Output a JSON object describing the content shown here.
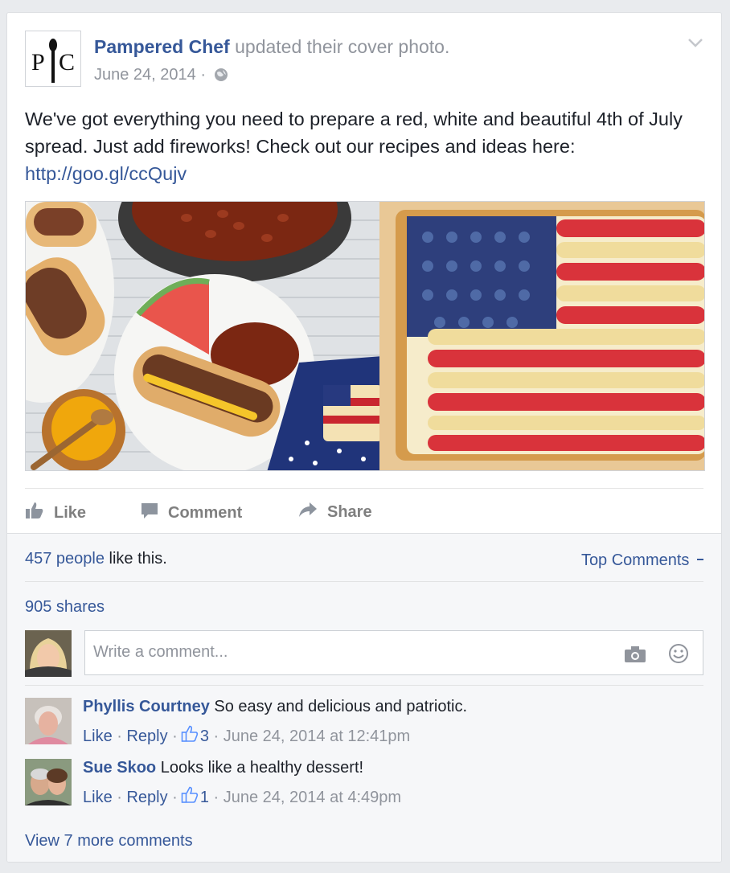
{
  "post": {
    "author": "Pampered Chef",
    "action": "updated their cover photo.",
    "date": "June 24, 2014",
    "separator": "·",
    "logo_text_left": "P",
    "logo_text_right": "C",
    "text": "We've got everything you need to prepare a red, white and beautiful 4th of July spread. Just add fireworks! Check out our recipes and ideas here: ",
    "link": "http://goo.gl/ccQujv"
  },
  "actions": {
    "like": "Like",
    "comment": "Comment",
    "share": "Share"
  },
  "ufi": {
    "likes_count": "457 people",
    "likes_suffix": " like this.",
    "top_comments": "Top Comments",
    "shares": "905 shares",
    "comment_placeholder": "Write a comment..."
  },
  "comments": [
    {
      "name": "Phyllis Courtney",
      "text": "So easy and delicious and patriotic.",
      "like": "Like",
      "reply": "Reply",
      "likes": "3",
      "timestamp": "June 24, 2014 at 12:41pm"
    },
    {
      "name": "Sue Skoo",
      "text": "Looks like a healthy dessert!",
      "like": "Like",
      "reply": "Reply",
      "likes": "1",
      "timestamp": "June 24, 2014 at 4:49pm"
    }
  ],
  "view_more": "View 7 more comments",
  "colors": {
    "link": "#365899",
    "meta": "#90949c",
    "background": "#e9ebee",
    "ufi_background": "#f6f7f9"
  },
  "icons": [
    "globe-icon",
    "chevron-down-icon",
    "like-icon",
    "comment-icon",
    "share-icon",
    "camera-icon",
    "smiley-icon",
    "thumbs-up-icon"
  ]
}
